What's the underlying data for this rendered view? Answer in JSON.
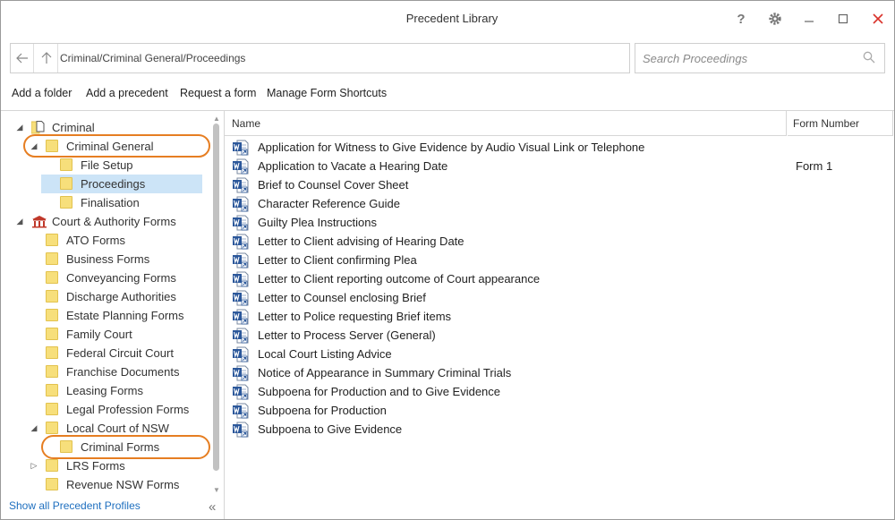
{
  "window": {
    "title": "Precedent Library"
  },
  "titlebar": {
    "help": "?",
    "settings": "gear",
    "minimize": "–",
    "maximize": "☐",
    "close": "✕"
  },
  "address": {
    "path": "Criminal/Criminal General/Proceedings"
  },
  "search": {
    "placeholder": "Search Proceedings"
  },
  "toolbar": {
    "add_folder": "Add a folder",
    "add_precedent": "Add a precedent",
    "request_form": "Request a form",
    "manage_shortcuts": "Manage Form Shortcuts"
  },
  "tree": [
    {
      "label": "Criminal",
      "level": 0,
      "toggle": "◢",
      "icon": "file-icon"
    },
    {
      "label": "Criminal General",
      "level": 1,
      "toggle": "◢",
      "icon": "folder-icon"
    },
    {
      "label": "File Setup",
      "level": 2,
      "toggle": "",
      "icon": "folder-icon"
    },
    {
      "label": "Proceedings",
      "level": 2,
      "toggle": "",
      "icon": "folder-icon",
      "selected": true
    },
    {
      "label": "Finalisation",
      "level": 2,
      "toggle": "",
      "icon": "folder-icon"
    },
    {
      "label": "Court & Authority Forms",
      "level": 0,
      "toggle": "◢",
      "icon": "courthouse-icon"
    },
    {
      "label": "ATO Forms",
      "level": 1,
      "toggle": "",
      "icon": "folder-icon"
    },
    {
      "label": "Business Forms",
      "level": 1,
      "toggle": "",
      "icon": "folder-icon"
    },
    {
      "label": "Conveyancing Forms",
      "level": 1,
      "toggle": "",
      "icon": "folder-icon"
    },
    {
      "label": "Discharge Authorities",
      "level": 1,
      "toggle": "",
      "icon": "folder-icon"
    },
    {
      "label": "Estate Planning Forms",
      "level": 1,
      "toggle": "",
      "icon": "folder-icon"
    },
    {
      "label": "Family Court",
      "level": 1,
      "toggle": "",
      "icon": "folder-icon"
    },
    {
      "label": "Federal Circuit Court",
      "level": 1,
      "toggle": "",
      "icon": "folder-icon"
    },
    {
      "label": "Franchise Documents",
      "level": 1,
      "toggle": "",
      "icon": "folder-icon"
    },
    {
      "label": "Leasing Forms",
      "level": 1,
      "toggle": "",
      "icon": "folder-icon"
    },
    {
      "label": "Legal Profession Forms",
      "level": 1,
      "toggle": "",
      "icon": "folder-icon"
    },
    {
      "label": "Local Court of NSW",
      "level": 1,
      "toggle": "◢",
      "icon": "folder-icon"
    },
    {
      "label": "Criminal Forms",
      "level": 2,
      "toggle": "",
      "icon": "folder-icon"
    },
    {
      "label": "LRS Forms",
      "level": 1,
      "toggle": "▷",
      "icon": "folder-icon"
    },
    {
      "label": "Revenue NSW Forms",
      "level": 1,
      "toggle": "",
      "icon": "folder-icon"
    }
  ],
  "footer": {
    "show_all": "Show all Precedent Profiles",
    "collapse": "«"
  },
  "columns": {
    "name": "Name",
    "form_number": "Form Number"
  },
  "documents": [
    {
      "name": "Application for Witness to Give Evidence by Audio Visual Link or Telephone",
      "form": ""
    },
    {
      "name": "Application to Vacate a Hearing Date",
      "form": "Form 1"
    },
    {
      "name": "Brief to Counsel Cover Sheet",
      "form": ""
    },
    {
      "name": "Character Reference Guide",
      "form": ""
    },
    {
      "name": "Guilty Plea Instructions",
      "form": ""
    },
    {
      "name": "Letter to Client advising of Hearing Date",
      "form": ""
    },
    {
      "name": "Letter to Client confirming Plea",
      "form": ""
    },
    {
      "name": "Letter to Client reporting outcome of Court appearance",
      "form": ""
    },
    {
      "name": "Letter to Counsel enclosing Brief",
      "form": ""
    },
    {
      "name": "Letter to Police requesting Brief items",
      "form": ""
    },
    {
      "name": "Letter to Process Server (General)",
      "form": ""
    },
    {
      "name": "Local Court Listing Advice",
      "form": ""
    },
    {
      "name": "Notice of Appearance in Summary Criminal Trials",
      "form": ""
    },
    {
      "name": "Subpoena for Production and to Give Evidence",
      "form": ""
    },
    {
      "name": "Subpoena for Production",
      "form": ""
    },
    {
      "name": "Subpoena to Give Evidence",
      "form": ""
    }
  ],
  "colors": {
    "accent": "#1e6fbf",
    "selection": "#cce4f7",
    "highlight": "#e67e22",
    "folder": "#f7df7b",
    "word": "#2b579a"
  }
}
